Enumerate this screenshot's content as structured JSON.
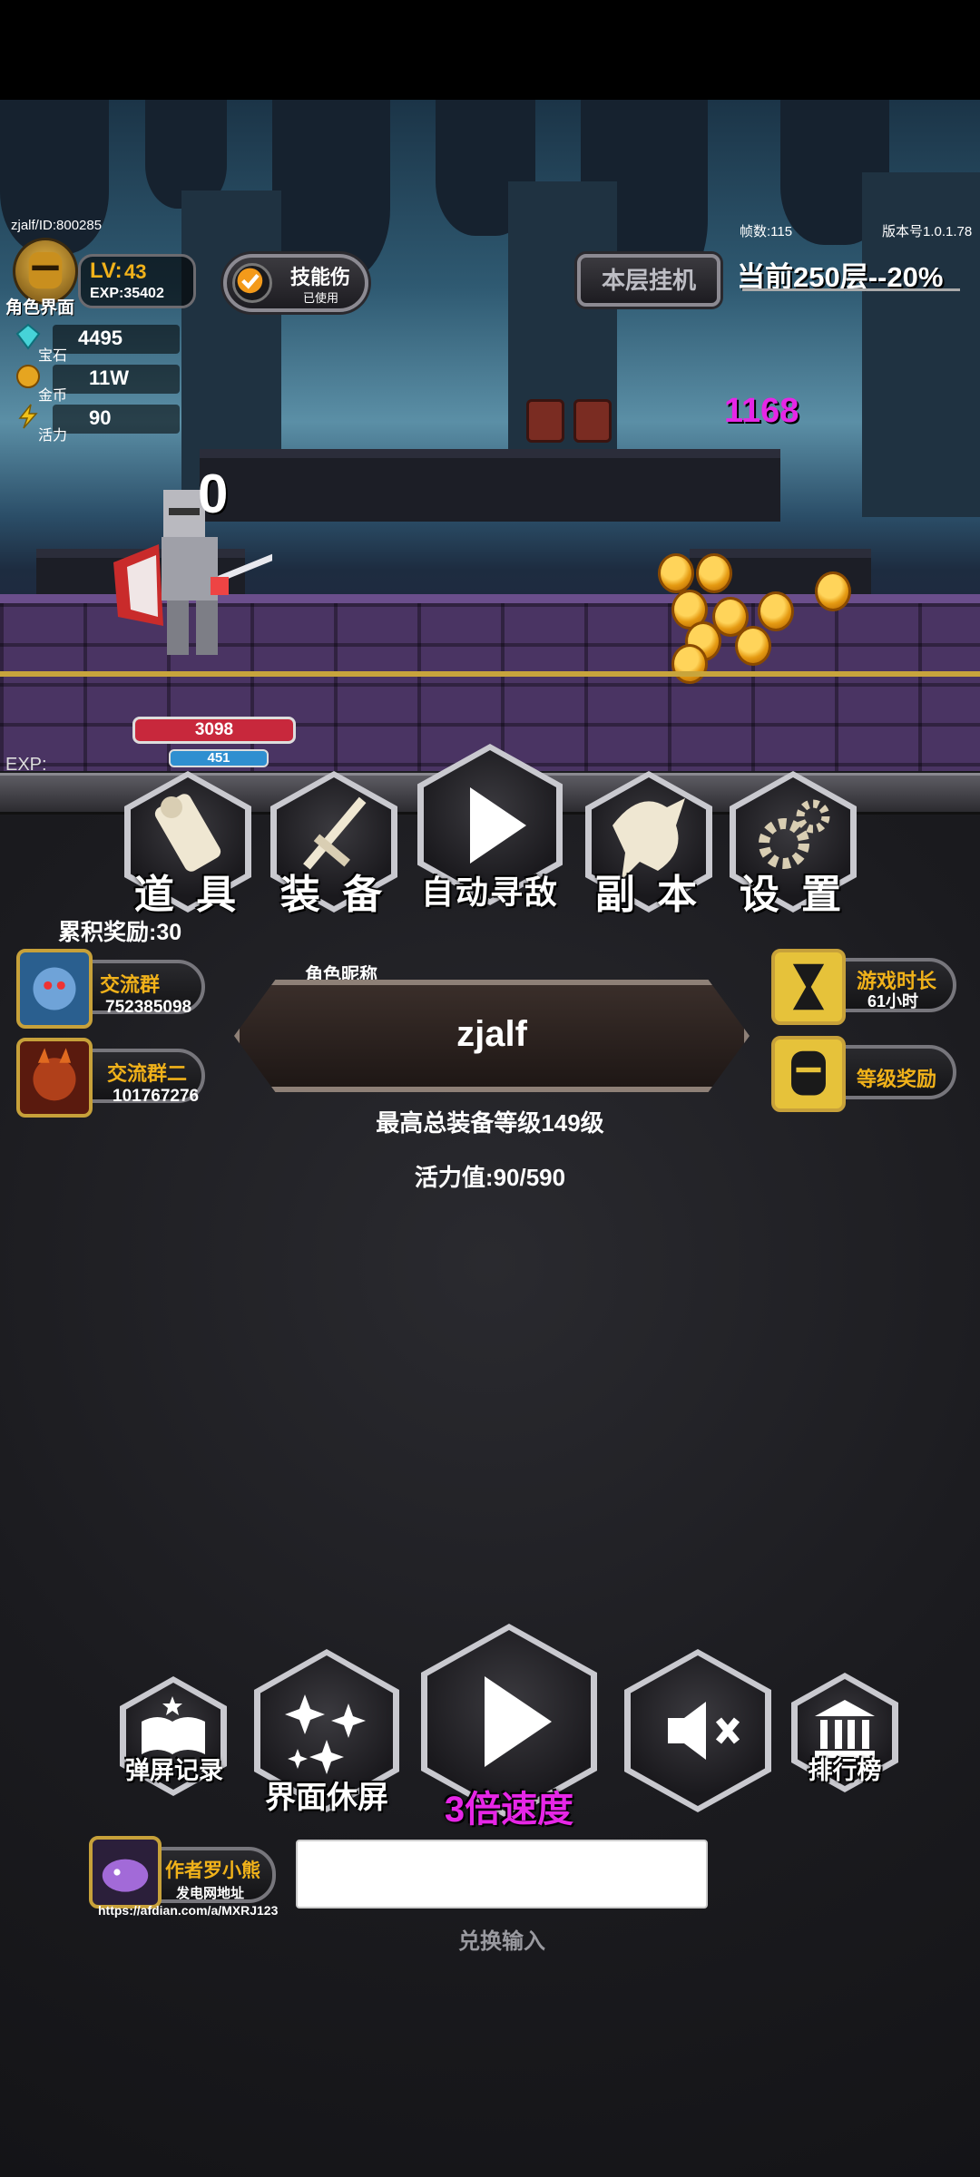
{
  "player": {
    "id_line": "zjalf/ID:800285",
    "level_prefix": "LV:",
    "level": "43",
    "exp": "EXP:35402",
    "character_label": "角色界面"
  },
  "skill_toggle": {
    "title": "技能伤",
    "sub": "已使用"
  },
  "stats": [
    {
      "icon": "gem-icon",
      "label": "宝石",
      "value": "4495"
    },
    {
      "icon": "gold-coin-icon",
      "label": "金币",
      "value": "11W"
    },
    {
      "icon": "energy-icon",
      "label": "活力",
      "value": "90"
    }
  ],
  "top_right": {
    "fps": "帧数:115",
    "version": "版本号1.0.1.78",
    "idle_button": "本层挂机",
    "floor_progress": "当前250层--20%"
  },
  "battle": {
    "damage_hit": "0",
    "enemy_damage": "1168",
    "hp": "3098",
    "mp": "451",
    "exp_label": "EXP:"
  },
  "main_menu": [
    {
      "label": "道 具",
      "icon": "scroll-icon"
    },
    {
      "label": "装 备",
      "icon": "sword-icon"
    },
    {
      "label": "自动寻敌",
      "icon": "play-icon"
    },
    {
      "label": "副 本",
      "icon": "dragon-icon"
    },
    {
      "label": "设 置",
      "icon": "gears-icon"
    }
  ],
  "reward": {
    "accumulated": "累积奖励:30"
  },
  "groups": [
    {
      "title": "交流群",
      "number": "752385098"
    },
    {
      "title": "交流群二",
      "number": "101767276"
    }
  ],
  "nickname": {
    "label": "角色昵称",
    "name": "zjalf"
  },
  "right_side": [
    {
      "title": "游戏时长",
      "sub": "61小时",
      "icon": "hourglass-icon"
    },
    {
      "title": "等级奖励",
      "sub": "",
      "icon": "helmet-icon"
    }
  ],
  "summary": {
    "max_equip": "最高总装备等级149级",
    "vitality": "活力值:90/590"
  },
  "bottom_menu": [
    {
      "label": "弹屏记录",
      "icon": "book-icon"
    },
    {
      "label": "界面休屏",
      "icon": "sparkles-icon"
    },
    {
      "label": "3倍速度",
      "icon": "play-icon"
    },
    {
      "label": "",
      "icon": "mute-icon"
    },
    {
      "label": "排行榜",
      "icon": "bank-icon"
    }
  ],
  "author": {
    "name": "作者罗小熊",
    "sub": "发电网地址",
    "url": "https://afdian.com/a/MXRJ123"
  },
  "redeem": {
    "value": "",
    "label": "兑换输入"
  },
  "colors": {
    "accent_gold": "#f1b21a",
    "speed_magenta": "#e626e6",
    "hp_red": "#c8283c",
    "mp_blue": "#2f8fd0"
  }
}
